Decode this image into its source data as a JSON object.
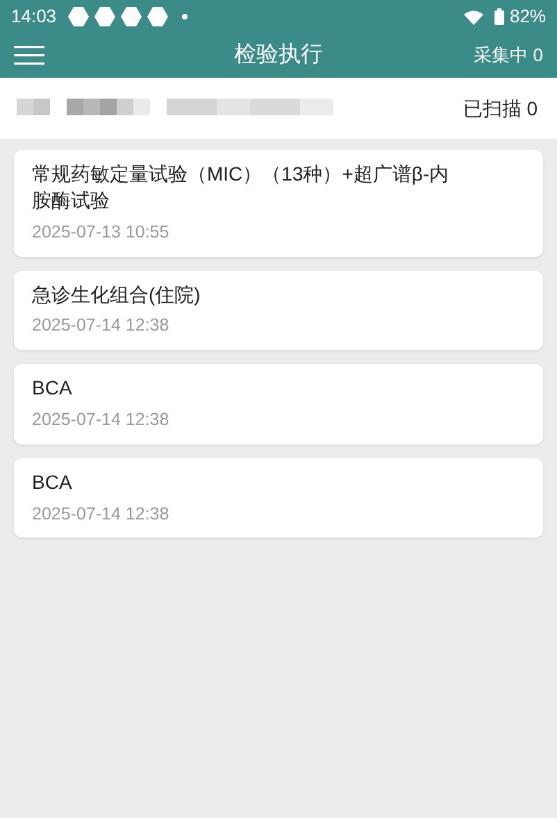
{
  "status_bar": {
    "time": "14:03",
    "battery": "82%"
  },
  "app_bar": {
    "title": "检验执行",
    "action": "采集中 0"
  },
  "summary": {
    "scanned": "已扫描 0"
  },
  "items": [
    {
      "title_lines": [
        "常规药敏定量试验（MIC）（13种）+超广谱β-内",
        "胺酶试验"
      ],
      "time": "2025-07-13 10:55"
    },
    {
      "title_lines": [
        "急诊生化组合(住院)"
      ],
      "time": "2025-07-14 12:38"
    },
    {
      "title_lines": [
        "BCA"
      ],
      "time": "2025-07-14 12:38"
    },
    {
      "title_lines": [
        "BCA"
      ],
      "time": "2025-07-14 12:38"
    }
  ]
}
